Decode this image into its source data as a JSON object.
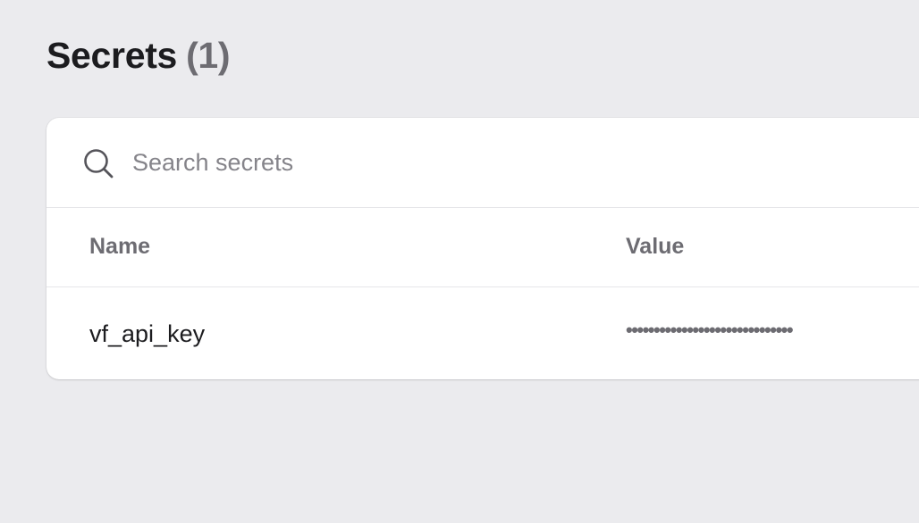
{
  "page": {
    "title": "Secrets",
    "count_label": "(1)"
  },
  "search": {
    "placeholder": "Search secrets",
    "value": "",
    "icon": "search-icon"
  },
  "table": {
    "columns": [
      "Name",
      "Value"
    ],
    "rows": [
      {
        "name": "vf_api_key",
        "value": "••••••••••••••••••••••••••••••"
      }
    ]
  },
  "colors": {
    "background": "#ebebee",
    "card": "#ffffff",
    "text": "#1c1c1f",
    "muted_text": "#6d6c72"
  }
}
